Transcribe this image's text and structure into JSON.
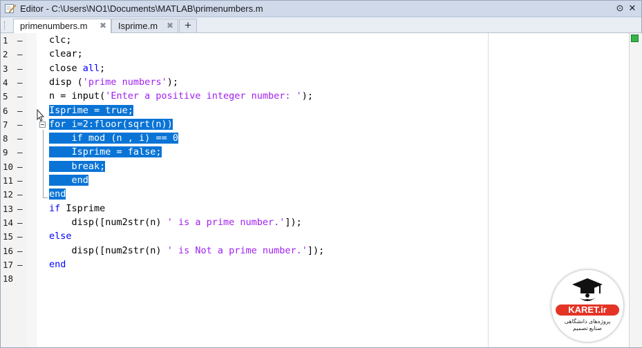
{
  "window": {
    "title": "Editor - C:\\Users\\NO1\\Documents\\MATLAB\\primenumbers.m",
    "menu_icon": "⊙",
    "close_icon": "✕"
  },
  "tabs": [
    {
      "label": "primenumbers.m",
      "active": true
    },
    {
      "label": "Isprime.m",
      "active": false
    }
  ],
  "tab_add_label": "+",
  "tab_close_glyph": "✖",
  "lines": [
    {
      "num": "1",
      "mark": "—",
      "text": "clc;"
    },
    {
      "num": "2",
      "mark": "—",
      "text": "clear;"
    },
    {
      "num": "3",
      "mark": "—",
      "text": "close all;"
    },
    {
      "num": "4",
      "mark": "—",
      "text": "disp ('prime numbers');"
    },
    {
      "num": "5",
      "mark": "—",
      "text": "n = input('Enter a positive integer number: ');"
    },
    {
      "num": "6",
      "mark": "—",
      "text": "Isprime = true;"
    },
    {
      "num": "7",
      "mark": "—",
      "text": "for i=2:floor(sqrt(n))"
    },
    {
      "num": "8",
      "mark": "—",
      "text": "    if mod (n , i) == 0"
    },
    {
      "num": "9",
      "mark": "—",
      "text": "    Isprime = false;"
    },
    {
      "num": "10",
      "mark": "—",
      "text": "    break;"
    },
    {
      "num": "11",
      "mark": "—",
      "text": "    end"
    },
    {
      "num": "12",
      "mark": "—",
      "text": "end"
    },
    {
      "num": "13",
      "mark": "—",
      "text": "if Isprime"
    },
    {
      "num": "14",
      "mark": "—",
      "text": "    disp([num2str(n) ' is a prime number.']);"
    },
    {
      "num": "15",
      "mark": "—",
      "text": "else"
    },
    {
      "num": "16",
      "mark": "—",
      "text": "    disp([num2str(n) ' is Not a prime number.']);"
    },
    {
      "num": "17",
      "mark": "—",
      "text": "end"
    },
    {
      "num": "18",
      "mark": "",
      "text": ""
    }
  ],
  "selection": {
    "from_line": 6,
    "to_line": 12
  },
  "logo": {
    "name": "KARET.ir",
    "tagline": "پروژه‌های دانشگاهی صنایع تصمیم"
  },
  "colors": {
    "selection": "#0a74d6",
    "keyword": "#0000ff",
    "string": "#a020f0",
    "status_indicator": "#35b44a"
  }
}
